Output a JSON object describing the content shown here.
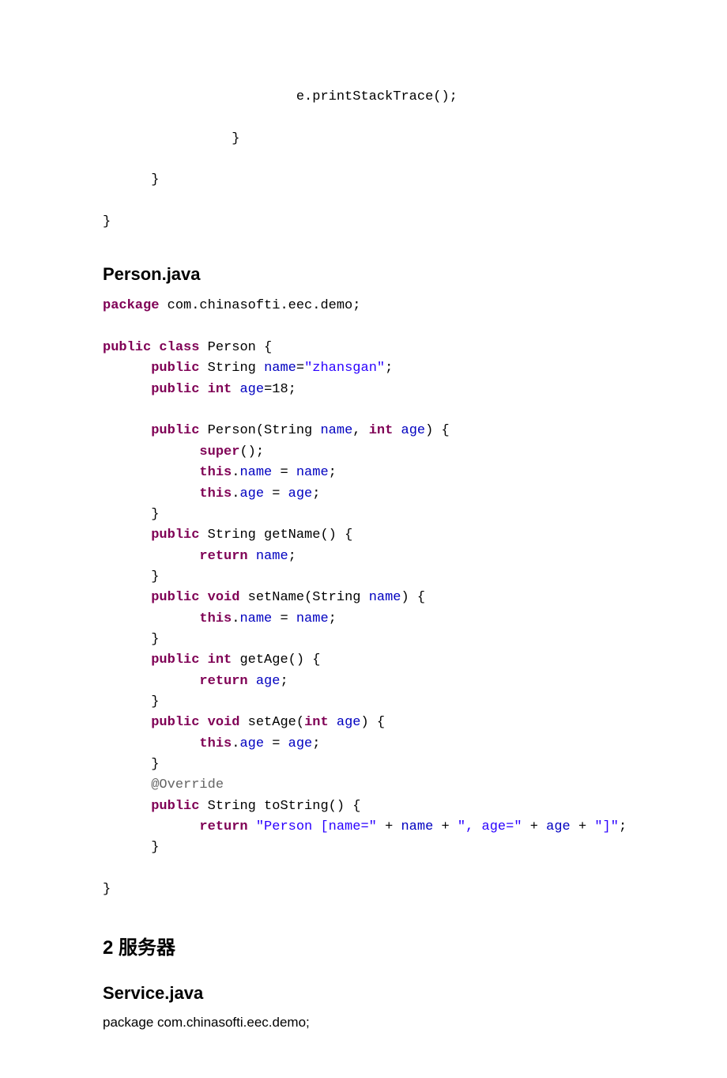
{
  "fragment_top": {
    "line1": "                        e.printStackTrace();",
    "line2": "                }",
    "line3": "      }",
    "line4": "}"
  },
  "heading_person": "Person.java",
  "person_code": {
    "pkg_kw": "package",
    "pkg_rest": " com.chinasofti.eec.demo;",
    "public": "public",
    "class": "class",
    "int": "int",
    "void": "void",
    "return": "return",
    "super": "super",
    "this": "this",
    "class_name": " Person {",
    "field_name_decl_pre": " String ",
    "field_name": "name",
    "field_name_eq": "=",
    "field_name_val": "\"zhansgan\"",
    "field_name_end": ";",
    "field_age_pre": " ",
    "field_age": "age",
    "field_age_rest": "=18;",
    "ctor_sig_pre": " Person(String ",
    "ctor_param_name": "name",
    "ctor_sig_mid": ", ",
    "ctor_param_age": "age",
    "ctor_sig_end": ") {",
    "super_call": "();",
    "dot": ".",
    "assign_name": " = ",
    "semicolon": ";",
    "get_name_sig": " String getName() {",
    "set_name_sig_pre": " setName(String ",
    "set_name_sig_end": ") {",
    "get_age_sig": " getAge() {",
    "set_age_sig_pre": " setAge(",
    "set_age_sig_end": ") {",
    "override": "@Override",
    "tostring_sig": " String toString() {",
    "ret_str1": "\"Person [name=\"",
    "ret_plus": " + ",
    "ret_str2": "\", age=\"",
    "ret_str3": "\"]\"",
    "close_brace": "      }",
    "close_class": "}"
  },
  "heading_server": "2 服务器",
  "heading_service": "Service.java",
  "service_line": "package com.chinasofti.eec.demo;"
}
